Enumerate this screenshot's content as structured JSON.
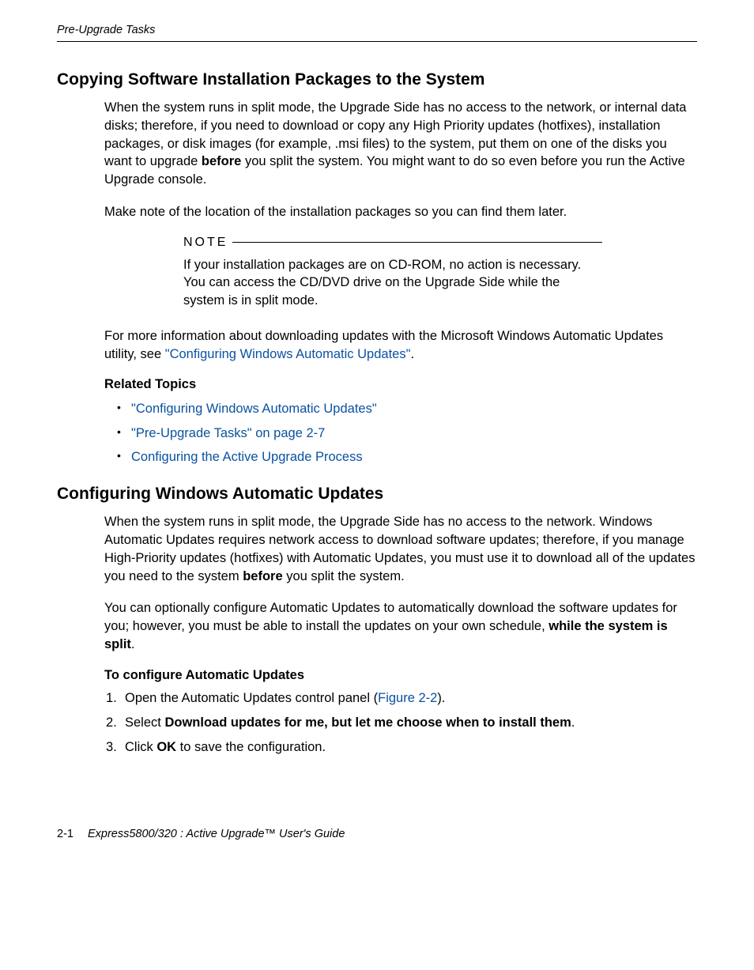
{
  "header": {
    "running": "Pre-Upgrade Tasks"
  },
  "section1": {
    "title": "Copying Software Installation Packages to the System",
    "p1_a": "When the system runs in split mode, the Upgrade Side has no access to the network, or internal data disks; therefore, if you need to download or copy any High Priority updates (hotfixes), installation packages, or disk images (for example, .msi files) to the system, put them on one of the disks you want to upgrade ",
    "p1_bold": "before",
    "p1_b": " you split the system. You might want to do so even before you run the Active Upgrade console.",
    "p2": "Make note of the location of the installation packages so you can find them later.",
    "note_label": "NOTE",
    "note_text": "If your installation packages are on CD-ROM, no action is necessary. You can access the CD/DVD drive on the Upgrade Side while the system is in split mode.",
    "p3_a": "For more information about downloading updates with the Microsoft Windows Automatic Updates utility, see ",
    "p3_link": "\"Configuring Windows Automatic Updates\"",
    "p3_b": ".",
    "related_heading": "Related Topics",
    "related": [
      "\"Configuring Windows Automatic Updates\"",
      "\"Pre-Upgrade Tasks\" on page 2-7",
      "Configuring the Active Upgrade Process"
    ]
  },
  "section2": {
    "title": "Configuring Windows Automatic Updates",
    "p1_a": "When the system runs in split mode, the Upgrade Side has no access to the network. Windows Automatic Updates requires network access to download software updates; therefore, if you manage High-Priority updates (hotfixes) with Automatic Updates, you must use it to download all of the updates you need to the system ",
    "p1_bold": "before",
    "p1_b": " you split the system.",
    "p2_a": "You can optionally configure Automatic Updates to automatically download the software updates for you; however, you must be able to install the updates on your own schedule, ",
    "p2_bold": "while the system is split",
    "p2_b": ".",
    "steps_heading": "To configure Automatic Updates",
    "steps": {
      "s1_a": "Open the Automatic Updates control panel (",
      "s1_link": "Figure 2-2",
      "s1_b": ").",
      "s2_a": "Select ",
      "s2_bold": "Download updates for me, but let me choose when to install them",
      "s2_b": ".",
      "s3_a": "Click ",
      "s3_bold": "OK",
      "s3_b": " to save the configuration."
    }
  },
  "footer": {
    "pgnum": "2-1",
    "title": "Express5800/320   : Active Upgrade™ User's Guide"
  }
}
